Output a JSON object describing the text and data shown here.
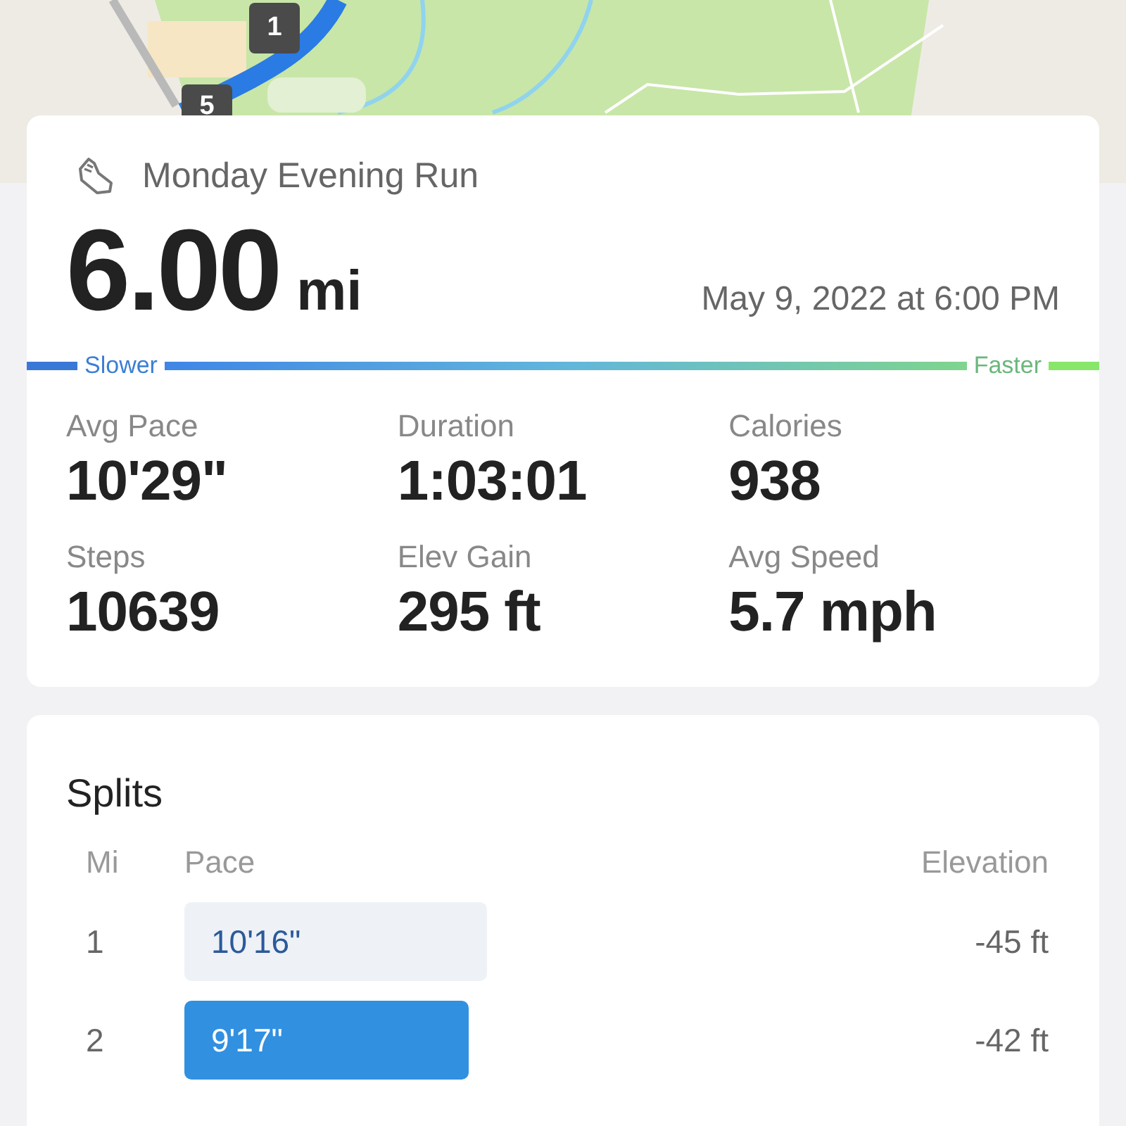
{
  "map": {
    "kind": "picture",
    "markers": [
      {
        "label": "1"
      },
      {
        "label": "5"
      }
    ]
  },
  "activity": {
    "title": "Monday Evening Run",
    "distance": "6.00",
    "unit": "mi",
    "date": "May 9, 2022 at 6:00 PM"
  },
  "pace_scale": {
    "slow_label": "Slower",
    "fast_label": "Faster"
  },
  "stats": [
    {
      "label": "Avg Pace",
      "value": "10'29\""
    },
    {
      "label": "Duration",
      "value": "1:03:01"
    },
    {
      "label": "Calories",
      "value": "938"
    },
    {
      "label": "Steps",
      "value": "10639"
    },
    {
      "label": "Elev Gain",
      "value": "295 ft"
    },
    {
      "label": "Avg Speed",
      "value": "5.7 mph"
    }
  ],
  "splits": {
    "title": "Splits",
    "columns": [
      "Mi",
      "Pace",
      "Elevation"
    ],
    "rows": [
      {
        "mile": "1",
        "pace": "10'16\"",
        "fastest": false,
        "elevation": "-45 ft"
      },
      {
        "mile": "2",
        "pace": "9'17\"",
        "fastest": true,
        "elevation": "-42 ft"
      }
    ]
  }
}
